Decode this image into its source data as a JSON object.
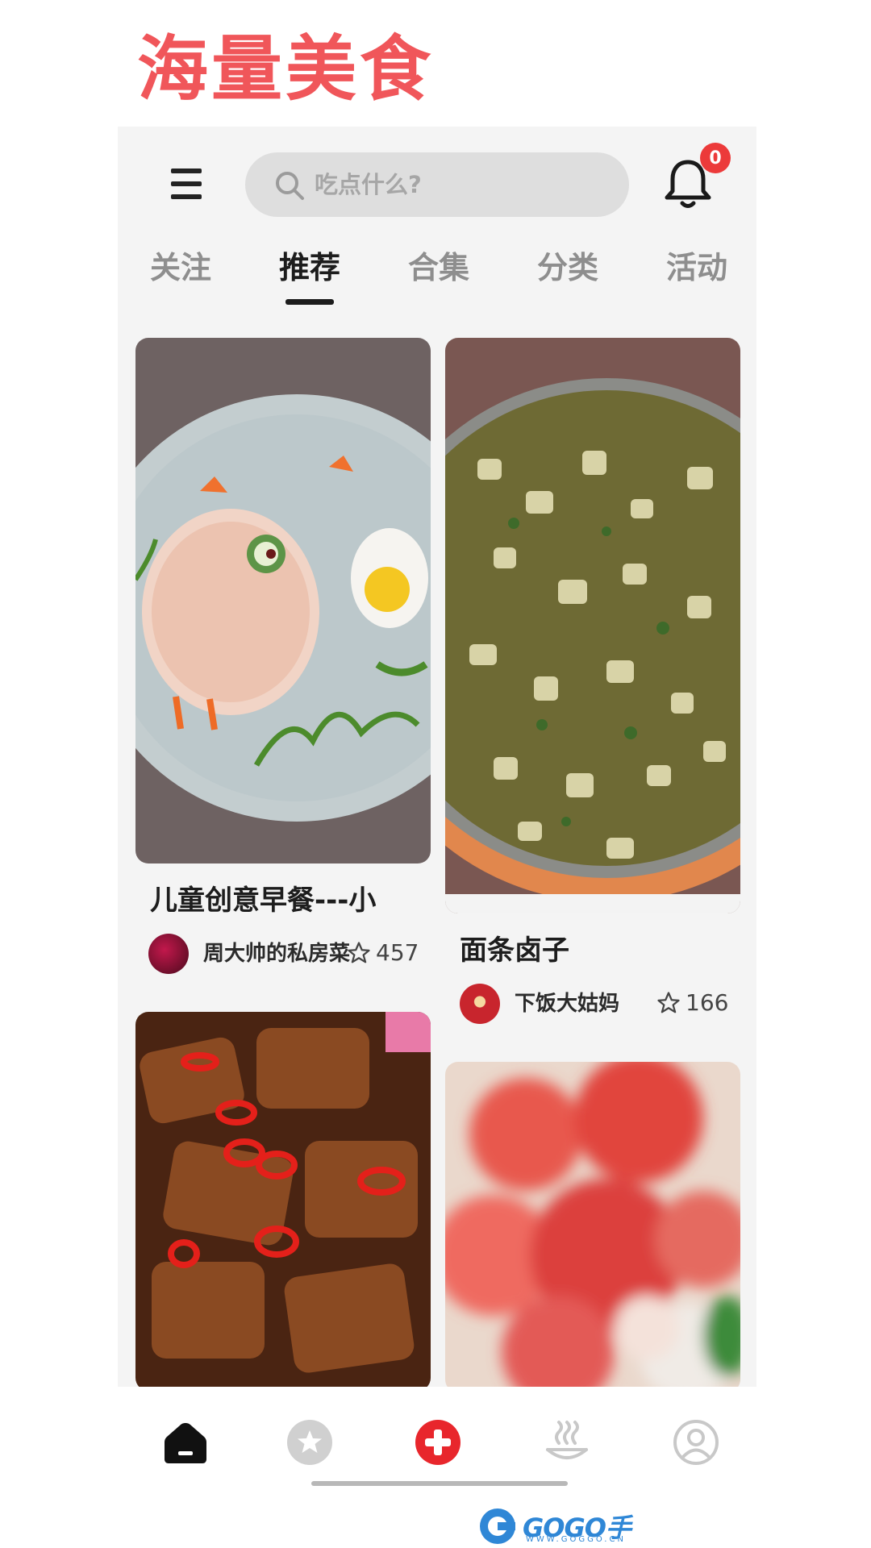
{
  "headline": "海量美食",
  "search": {
    "placeholder": "吃点什么?"
  },
  "notifications": {
    "count": "0"
  },
  "tabs": [
    {
      "label": "关注",
      "active": false
    },
    {
      "label": "推荐",
      "active": true
    },
    {
      "label": "合集",
      "active": false
    },
    {
      "label": "分类",
      "active": false
    },
    {
      "label": "活动",
      "active": false
    }
  ],
  "feed": [
    {
      "title": "儿童创意早餐---小",
      "author": "周大帅的私房菜",
      "likes": "457",
      "image": "chick-rice-plate"
    },
    {
      "title": "面条卤子",
      "author": "下饭大姑妈",
      "likes": "166",
      "image": "noodle-sauce-pot"
    },
    {
      "title": "",
      "author": "",
      "likes": "",
      "image": "braised-ribs-chili"
    },
    {
      "title": "",
      "author": "",
      "likes": "",
      "image": "red-dessert-blurry"
    }
  ],
  "bottom_nav": [
    "home-icon",
    "star-icon",
    "add-icon",
    "hot-icon",
    "profile-icon"
  ],
  "watermark": {
    "brand": "GOGO手游网",
    "url": "WWW.GOGGO.CN"
  },
  "colors": {
    "accent": "#f0565a",
    "add_button": "#e8262c",
    "badge": "#ec3a3a"
  }
}
